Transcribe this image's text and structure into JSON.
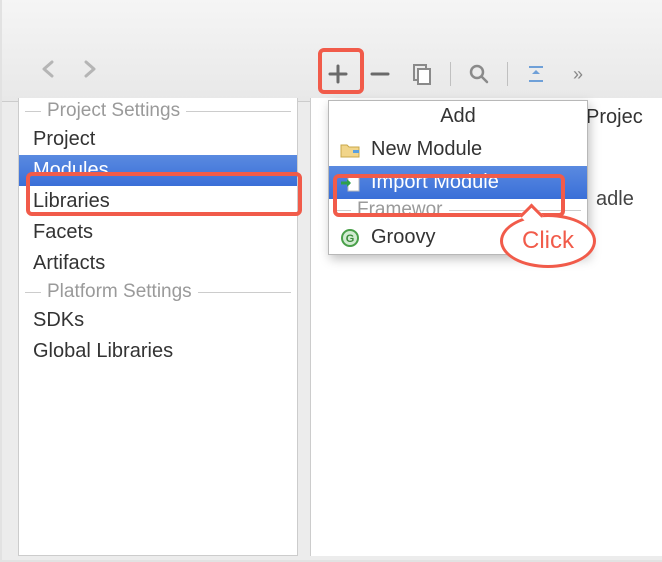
{
  "nav": {
    "back": "‹",
    "forward": "›"
  },
  "sidebar": {
    "section1": "Project Settings",
    "items1": [
      "Project",
      "Modules",
      "Libraries",
      "Facets",
      "Artifacts"
    ],
    "section2": "Platform Settings",
    "items2": [
      "SDKs",
      "Global Libraries"
    ],
    "selected": "Modules"
  },
  "toolbar": {
    "add": "+",
    "remove": "−",
    "copy": "⧉",
    "search": "🔍",
    "expand": "⇵",
    "more": "»"
  },
  "rightHeader": "Projec",
  "belowText": "adle",
  "dropdown": {
    "title": "Add",
    "items": [
      {
        "label": "New Module",
        "icon": "folder-new"
      },
      {
        "label": "Import Module",
        "icon": "import"
      }
    ],
    "frameworksHeader": "Framewor",
    "frameworks": [
      {
        "label": "Groovy",
        "icon": "groovy"
      }
    ],
    "selected": "Import Module"
  },
  "annotation": {
    "click": "Click"
  }
}
